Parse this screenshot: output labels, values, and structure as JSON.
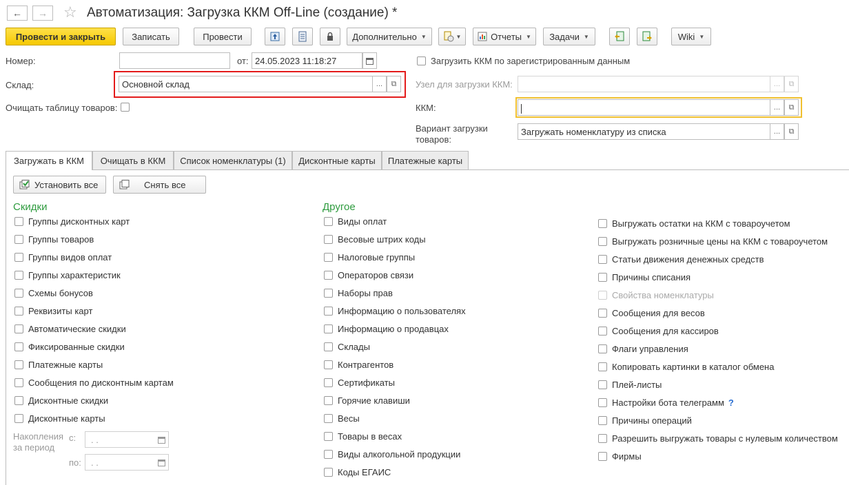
{
  "window": {
    "title": "Автоматизация: Загрузка ККМ Off-Line (создание) *",
    "back_icon": "←",
    "forward_icon": "→",
    "star_icon": "☆"
  },
  "toolbar": {
    "post_close": "Провести и закрыть",
    "write": "Записать",
    "post": "Провести",
    "more": "Дополнительно",
    "reports": "Отчеты",
    "tasks": "Задачи",
    "wiki": "Wiki"
  },
  "header": {
    "number_label": "Номер:",
    "number_value": "",
    "date_label": "от:",
    "date_value": "24.05.2023 11:18:27",
    "warehouse_label": "Склад:",
    "warehouse_value": "Основной склад",
    "clear_label": "Очищать таблицу товаров:",
    "load_registered_label": "Загрузить ККМ по зарегистрированным данным",
    "node_label": "Узел для загрузки ККМ:",
    "node_value": "",
    "kkm_label": "ККМ:",
    "kkm_value": "",
    "variant_label_1": "Вариант загрузки",
    "variant_label_2": "товаров:",
    "variant_value": "Загружать номенклатуру из списка",
    "ellipsis": "...",
    "open_glyph": "⧉"
  },
  "tabs": [
    {
      "label": "Загружать в ККМ"
    },
    {
      "label": "Очищать в ККМ"
    },
    {
      "label": "Список номенклатуры (1)"
    },
    {
      "label": "Дисконтные карты"
    },
    {
      "label": "Платежные карты"
    }
  ],
  "actions": {
    "set_all": "Установить все",
    "clear_all": "Снять все"
  },
  "discounts": {
    "title": "Скидки",
    "items": [
      {
        "label": "Группы дисконтных карт"
      },
      {
        "label": "Группы товаров"
      },
      {
        "label": "Группы видов оплат"
      },
      {
        "label": "Группы характеристик"
      },
      {
        "label": "Схемы бонусов"
      },
      {
        "label": "Реквизиты карт"
      },
      {
        "label": "Автоматические скидки"
      },
      {
        "label": "Фиксированные скидки"
      },
      {
        "label": "Платежные карты"
      },
      {
        "label": "Сообщения по дисконтным картам"
      },
      {
        "label": "Дисконтные скидки"
      },
      {
        "label": "Дисконтные карты"
      }
    ],
    "accum_label_1": "Накопления",
    "accum_label_2": "за период",
    "from_label": "с:",
    "to_label": "по:",
    "from_value": ". .",
    "to_value": ". ."
  },
  "other": {
    "title": "Другое",
    "items": [
      {
        "label": "Виды оплат"
      },
      {
        "label": "Весовые штрих коды"
      },
      {
        "label": "Налоговые группы"
      },
      {
        "label": "Операторов связи"
      },
      {
        "label": "Наборы прав"
      },
      {
        "label": "Информацию о пользователях"
      },
      {
        "label": "Информацию о продавцах"
      },
      {
        "label": "Склады"
      },
      {
        "label": "Контрагентов"
      },
      {
        "label": "Сертификаты"
      },
      {
        "label": "Горячие клавиши"
      },
      {
        "label": "Весы"
      },
      {
        "label": "Товары в весах"
      },
      {
        "label": "Виды алкогольной продукции"
      },
      {
        "label": "Коды ЕГАИС"
      }
    ]
  },
  "third": {
    "items": [
      {
        "label": "Выгружать остатки на ККМ с товароучетом"
      },
      {
        "label": "Выгружать розничные цены на ККМ с товароучетом"
      },
      {
        "label": "Статьи движения денежных средств"
      },
      {
        "label": "Причины списания"
      },
      {
        "label": "Свойства номенклатуры"
      },
      {
        "label": "Сообщения для весов"
      },
      {
        "label": "Сообщения для кассиров"
      },
      {
        "label": "Флаги управления"
      },
      {
        "label": "Копировать картинки в каталог обмена"
      },
      {
        "label": "Плей-листы"
      },
      {
        "label": "Настройки бота телеграмм"
      },
      {
        "label": "Причины операций"
      },
      {
        "label": "Разрешить выгружать товары с нулевым количеством"
      },
      {
        "label": "Фирмы"
      }
    ],
    "help_mark": "?"
  },
  "colors": {
    "accent_yellow": "#f5c900",
    "section_green": "#2e9b3e",
    "highlight_red": "#e31b1b",
    "focus_yellow": "#f0c030"
  }
}
